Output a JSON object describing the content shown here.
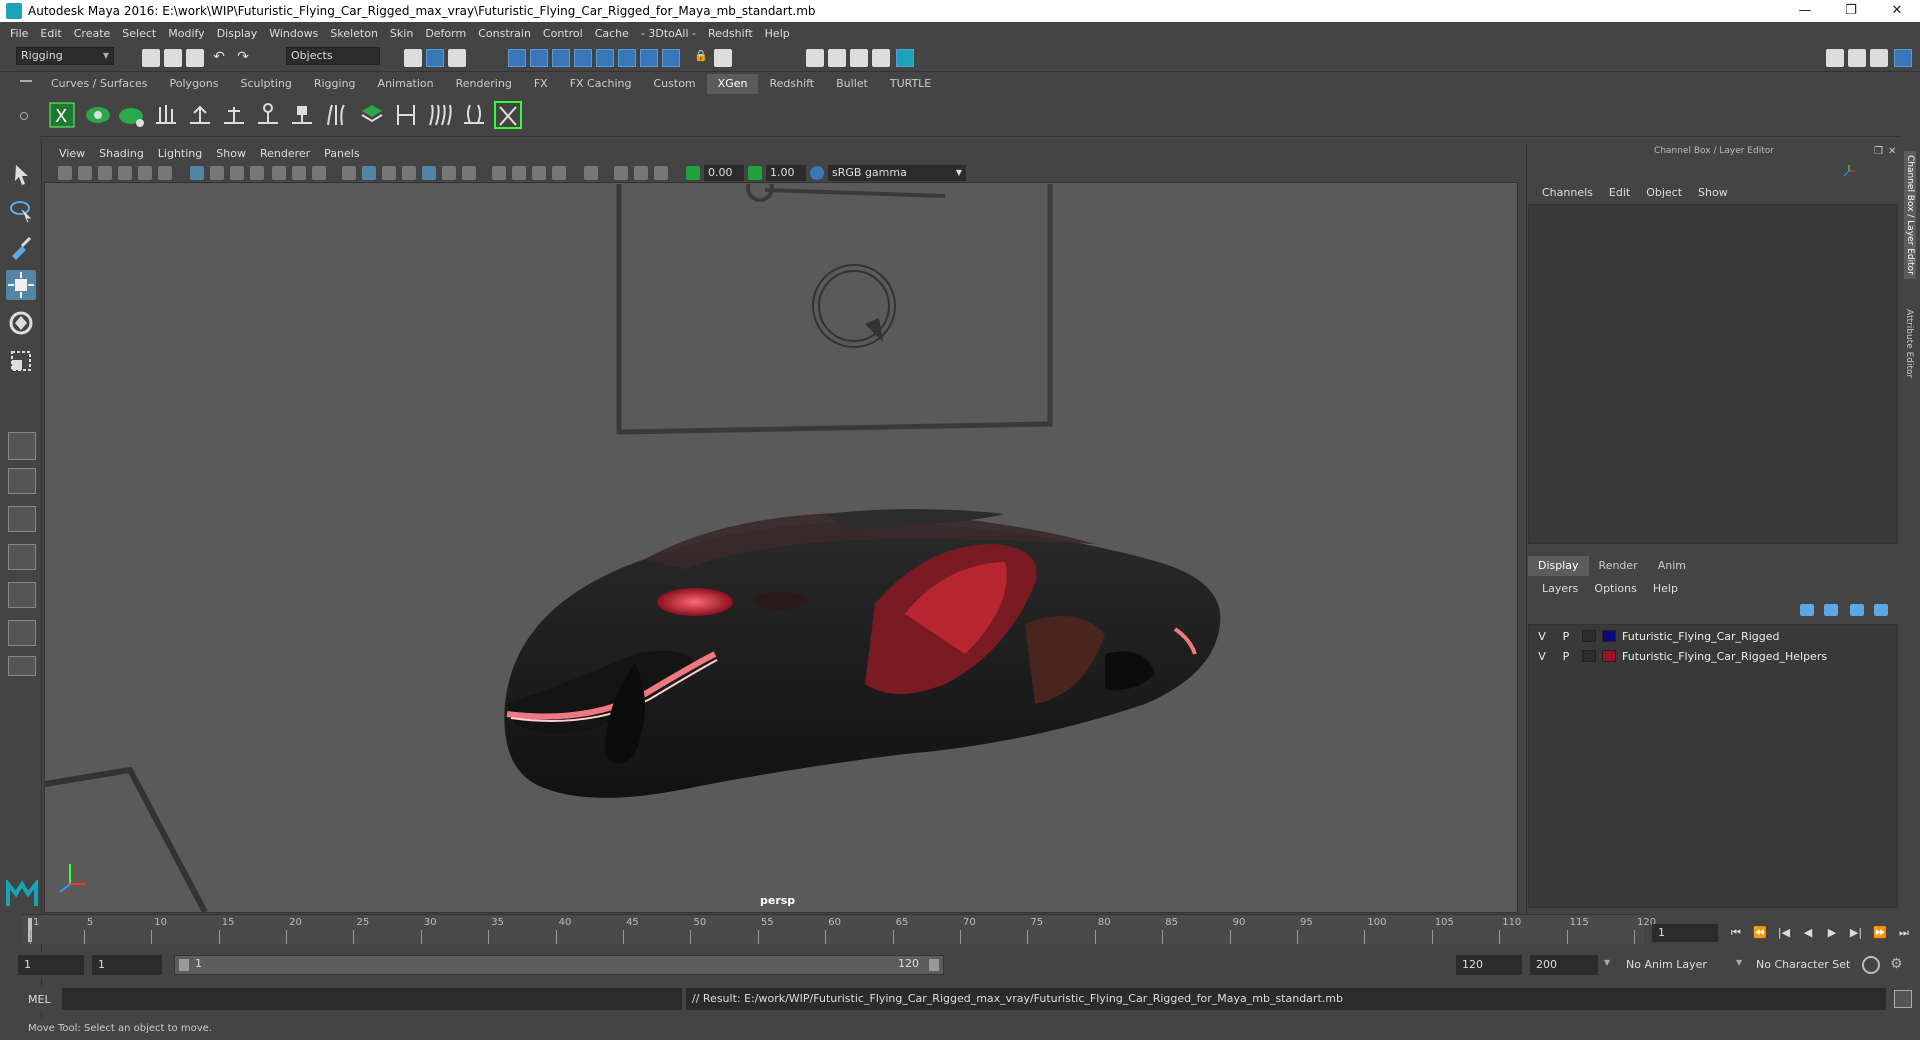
{
  "window": {
    "title": "Autodesk Maya 2016: E:\\work\\WIP\\Futuristic_Flying_Car_Rigged_max_vray\\Futuristic_Flying_Car_Rigged_for_Maya_mb_standart.mb",
    "minimize": "—",
    "maximize": "❐",
    "close": "✕"
  },
  "menus": [
    "File",
    "Edit",
    "Create",
    "Select",
    "Modify",
    "Display",
    "Windows",
    "Skeleton",
    "Skin",
    "Deform",
    "Constrain",
    "Control",
    "Cache",
    "- 3DtoAll -",
    "Redshift",
    "Help"
  ],
  "statusline": {
    "mode": "Rigging",
    "selection_mask": "Objects"
  },
  "shelf_tabs": [
    "Curves / Surfaces",
    "Polygons",
    "Sculpting",
    "Rigging",
    "Animation",
    "Rendering",
    "FX",
    "FX Caching",
    "Custom",
    "XGen",
    "Redshift",
    "Bullet",
    "TURTLE"
  ],
  "shelf_active_tab": "XGen",
  "panel_menus": [
    "View",
    "Shading",
    "Lighting",
    "Show",
    "Renderer",
    "Panels"
  ],
  "panel_fields": {
    "exposure": "0.00",
    "gamma": "1.00",
    "colorspace": "sRGB gamma"
  },
  "viewport": {
    "camera_label": "persp"
  },
  "channel_box": {
    "title": "Channel Box / Layer Editor",
    "menus": [
      "Channels",
      "Edit",
      "Object",
      "Show"
    ],
    "layer_tabs": [
      "Display",
      "Render",
      "Anim"
    ],
    "active_layer_tab": "Display",
    "layer_menus": [
      "Layers",
      "Options",
      "Help"
    ],
    "layers": [
      {
        "v": "V",
        "p": "P",
        "name": "Futuristic_Flying_Car_Rigged",
        "color": "#0a0a7a"
      },
      {
        "v": "V",
        "p": "P",
        "name": "Futuristic_Flying_Car_Rigged_Helpers",
        "color": "#a0102a"
      }
    ]
  },
  "side_tabs": [
    "Channel Box / Layer Editor",
    "Attribute Editor"
  ],
  "timeline": {
    "ticks": [
      "1",
      "5",
      "10",
      "15",
      "20",
      "25",
      "30",
      "35",
      "40",
      "45",
      "50",
      "55",
      "60",
      "65",
      "70",
      "75",
      "80",
      "85",
      "90",
      "95",
      "100",
      "105",
      "110",
      "115",
      "120"
    ],
    "current_frame": "1"
  },
  "range": {
    "start": "1",
    "playback_start": "1",
    "slider_start": "1",
    "slider_end": "120",
    "playback_end": "120",
    "end": "200",
    "anim_layer": "No Anim Layer",
    "character_set": "No Character Set"
  },
  "command": {
    "language": "MEL",
    "result": "// Result: E:/work/WIP/Futuristic_Flying_Car_Rigged_max_vray/Futuristic_Flying_Car_Rigged_for_Maya_mb_standart.mb"
  },
  "help_line": "Move Tool: Select an object to move.",
  "colors": {
    "accent": "#5285a6",
    "shelf_green": "#1ea33c",
    "car_body": "#1a1a1a",
    "car_glow": "#e8404a"
  }
}
